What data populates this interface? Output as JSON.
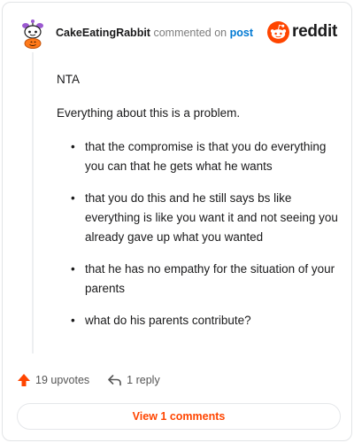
{
  "comment": {
    "username": "CakeEatingRabbit",
    "action_text": "commented on",
    "target_text": "post",
    "brand_word": "reddit",
    "paragraphs": [
      "NTA",
      "Everything about this is a problem."
    ],
    "bullets": [
      "that the compromise is that you do everything you can that he gets what he wants",
      "that you do this and he still says bs like everything is like you want it and not seeing you already gave up what you wanted",
      "that he has no empathy for the situation of your parents",
      "what do his parents contribute?"
    ]
  },
  "actions": {
    "upvotes_label": "19 upvotes",
    "reply_label": "1 reply",
    "view_comments_label": "View 1 comments"
  },
  "colors": {
    "brand_orange": "#ff4500",
    "link_blue": "#0079d3"
  },
  "icons": [
    "avatar-snoo",
    "reddit-logo-icon",
    "upvote-arrow-icon",
    "reply-icon"
  ]
}
